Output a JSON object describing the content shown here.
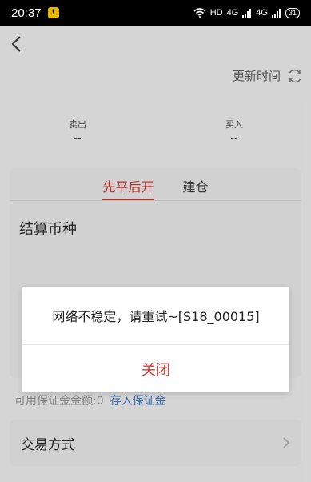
{
  "status": {
    "time": "20:37",
    "badge": "!",
    "network": "HD",
    "signal1": "4G",
    "signal2": "4G",
    "battery": "31"
  },
  "header": {
    "update_label": "更新时间"
  },
  "prices": {
    "sell_label": "卖出",
    "sell_value": "--",
    "buy_label": "买入",
    "buy_value": "--"
  },
  "tabs": [
    {
      "label": "先平后开",
      "active": true
    },
    {
      "label": "建仓",
      "active": false
    }
  ],
  "form": {
    "currency_label": "结算币种"
  },
  "margin": {
    "available_text": "可用保证金金额:0",
    "deposit_link": "存入保证金"
  },
  "trade": {
    "method_label": "交易方式"
  },
  "dialog": {
    "message": "网络不稳定，请重试~[S18_00015]",
    "close_label": "关闭"
  },
  "colors": {
    "accent_red": "#c9352f",
    "link_blue": "#3c74b8"
  }
}
